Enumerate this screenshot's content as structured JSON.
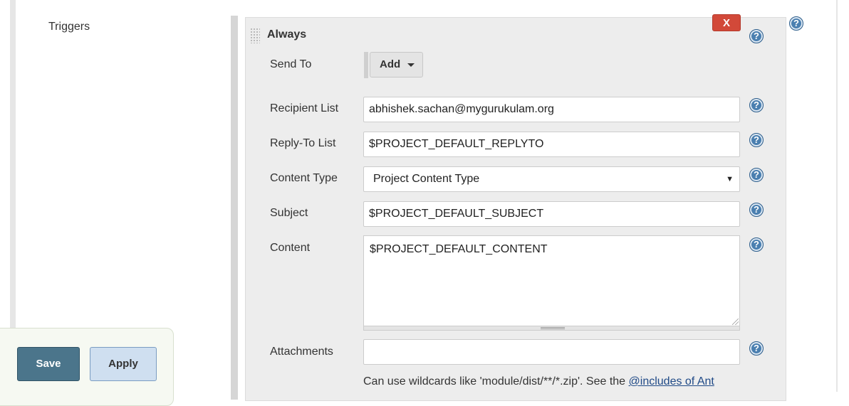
{
  "section": {
    "label": "Triggers"
  },
  "trigger": {
    "title": "Always",
    "delete_label": "X",
    "help_symbol": "?",
    "fields": {
      "send_to": {
        "label": "Send To",
        "button_label": "Add"
      },
      "recipient_list": {
        "label": "Recipient List",
        "value": "abhishek.sachan@mygurukulam.org"
      },
      "reply_to_list": {
        "label": "Reply-To List",
        "value": "$PROJECT_DEFAULT_REPLYTO"
      },
      "content_type": {
        "label": "Content Type",
        "selected": "Project Content Type",
        "arrow": "▼"
      },
      "subject": {
        "label": "Subject",
        "value": "$PROJECT_DEFAULT_SUBJECT"
      },
      "content": {
        "label": "Content",
        "value": "$PROJECT_DEFAULT_CONTENT"
      },
      "attachments": {
        "label": "Attachments",
        "value": ""
      }
    },
    "attachments_help": {
      "text": "Can use wildcards like 'module/dist/**/*.zip'. See the ",
      "link": "@includes of Ant"
    }
  },
  "footer": {
    "save_label": "Save",
    "apply_label": "Apply"
  },
  "colors": {
    "delete": "#d24939",
    "help_icon": "#4a7fb0",
    "save_button": "#4b758b",
    "apply_button": "#cfdff0",
    "link": "#204a87"
  }
}
